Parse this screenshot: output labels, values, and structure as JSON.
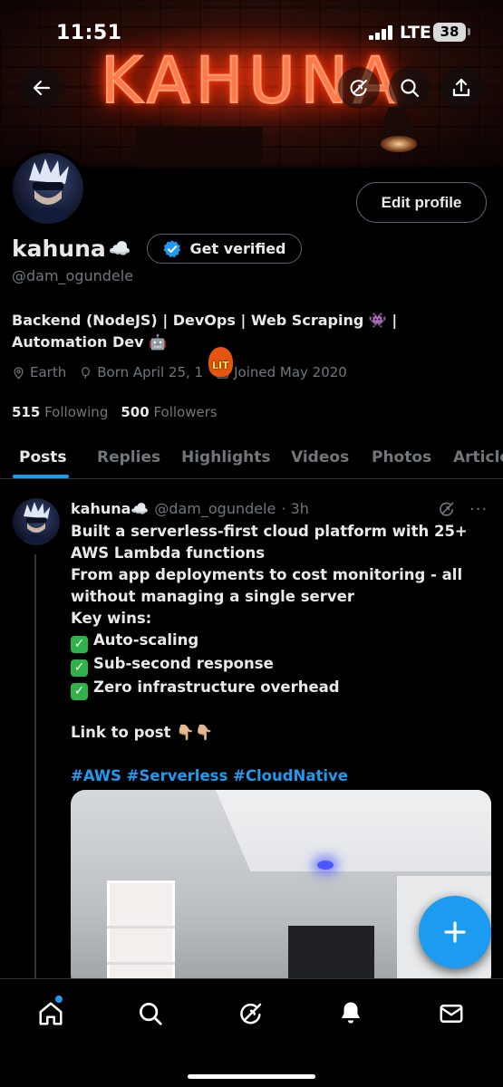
{
  "status_bar": {
    "time": "11:51",
    "network": "LTE",
    "battery": "38"
  },
  "banner": {
    "text": "KAHUNA"
  },
  "nav": {
    "back_icon": "arrow-left-icon",
    "grok_icon": "grok-icon",
    "search_icon": "search-icon",
    "share_icon": "share-icon"
  },
  "profile": {
    "edit_button": "Edit profile",
    "display_name": "kahuna",
    "name_emoji": "☁️",
    "get_verified": "Get verified",
    "handle": "@dam_ogundele",
    "bio_line1": "Backend (NodeJS) | DevOps | Web Scraping 👾 |",
    "bio_line2": "Automation Dev 🤖",
    "location": "Earth",
    "born": "Born April 25, 1",
    "lit_badge": "LIT",
    "joined": "Joined May 2020",
    "following_count": "515",
    "following_label": "Following",
    "followers_count": "500",
    "followers_label": "Followers"
  },
  "tabs": [
    "Posts",
    "Replies",
    "Highlights",
    "Videos",
    "Photos",
    "Article"
  ],
  "post": {
    "name": "kahuna☁️",
    "handle": "@dam_ogundele",
    "time": "· 3h",
    "more": "···",
    "lines": [
      "Built a serverless-first cloud platform with 25+",
      "AWS Lambda functions",
      "From app deployments to cost monitoring - all",
      "without managing a single server",
      "Key wins:"
    ],
    "wins": [
      "Auto-scaling",
      "Sub-second response",
      "Zero infrastructure overhead"
    ],
    "link_line": "Link to post 👇🏼👇🏼",
    "hashtags": "#AWS #Serverless #CloudNative"
  },
  "fab": {
    "icon": "plus-icon"
  },
  "bottom_nav": [
    "home-icon",
    "search-icon",
    "grok-icon",
    "bell-icon",
    "mail-icon"
  ],
  "colors": {
    "accent": "#1d9bf0",
    "muted": "#71767b",
    "text": "#e7e9ea",
    "neon": "#ff7a4a"
  }
}
